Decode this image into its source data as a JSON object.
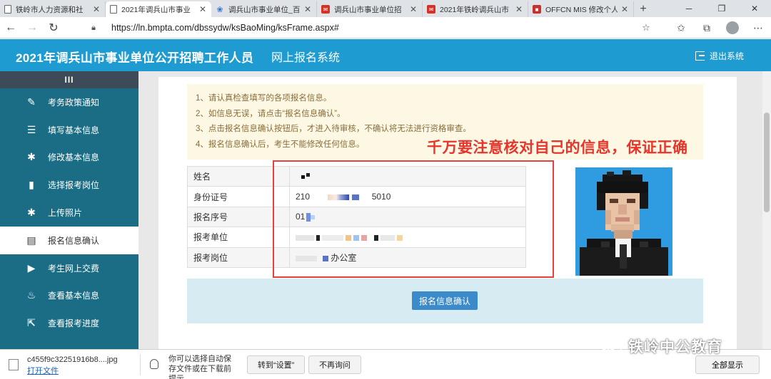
{
  "browser": {
    "tabs": [
      {
        "title": "铁岭市人力资源和社",
        "icon": "document-icon",
        "active": false
      },
      {
        "title": "2021年调兵山市事业",
        "icon": "document-icon",
        "active": true
      },
      {
        "title": "调兵山市事业单位_百度",
        "icon": "baidu-paw-icon",
        "active": false
      },
      {
        "title": "调兵山市事业单位招",
        "icon": "offcn-icon",
        "active": false
      },
      {
        "title": "2021年铁岭调兵山市",
        "icon": "offcn-icon",
        "active": false
      },
      {
        "title": "OFFCN MIS 修改个人",
        "icon": "offcn-mis-icon",
        "active": false
      }
    ],
    "url": "https://ln.bmpta.com/dbssydw/ksBaoMing/ksFrame.aspx#"
  },
  "header": {
    "title": "2021年调兵山市事业单位公开招聘工作人员",
    "subtitle": "网上报名系统",
    "logout_label": "退出系统"
  },
  "sidebar": {
    "toggle_label": "III",
    "items": [
      {
        "label": "考务政策通知",
        "icon": "edit-icon",
        "active": false
      },
      {
        "label": "填写基本信息",
        "icon": "list-icon",
        "active": false
      },
      {
        "label": "修改基本信息",
        "icon": "gear-icon",
        "active": false
      },
      {
        "label": "选择报考岗位",
        "icon": "book-icon",
        "active": false
      },
      {
        "label": "上传照片",
        "icon": "gear-icon",
        "active": false
      },
      {
        "label": "报名信息确认",
        "icon": "id-card-icon",
        "active": true
      },
      {
        "label": "考生网上交费",
        "icon": "play-icon",
        "active": false
      },
      {
        "label": "查看基本信息",
        "icon": "fire-icon",
        "active": false
      },
      {
        "label": "查看报考进度",
        "icon": "external-link-icon",
        "active": false
      }
    ]
  },
  "notice": {
    "lines": [
      "1、请认真检查填写的各项报名信息。",
      "2、如信息无误，请点击“报名信息确认”。",
      "3、点击报名信息确认按钮后，才进入待审核，不确认将无法进行资格审查。",
      "4、报名信息确认后，考生不能修改任何信息。"
    ]
  },
  "info": {
    "rows": [
      {
        "label": "姓名",
        "value": ""
      },
      {
        "label": "身份证号",
        "value_prefix": "210",
        "value_suffix": "5010"
      },
      {
        "label": "报名序号",
        "value": "01"
      },
      {
        "label": "报考单位",
        "value": ""
      },
      {
        "label": "报考岗位",
        "value_suffix": "办公室"
      }
    ]
  },
  "confirm_button": "报名信息确认",
  "annotation": "千万要注意核对自己的信息，保证正确",
  "download": {
    "filename": "c455f9c32251916b8....jpg",
    "open_label": "打开文件",
    "hint": "你可以选择自动保存文件或在下载前提示。",
    "settings_label": "转到“设置”",
    "ignore_label": "不再询问",
    "show_all_label": "全部显示"
  },
  "watermark": "铁岭中公教育",
  "colors": {
    "header_bg": "#1e9bd0",
    "sidebar_bg": "#1b6d85",
    "notice_bg": "#fcf8e3",
    "confirm_bg": "#3b8ac9",
    "annotation_red": "#e8352c"
  }
}
